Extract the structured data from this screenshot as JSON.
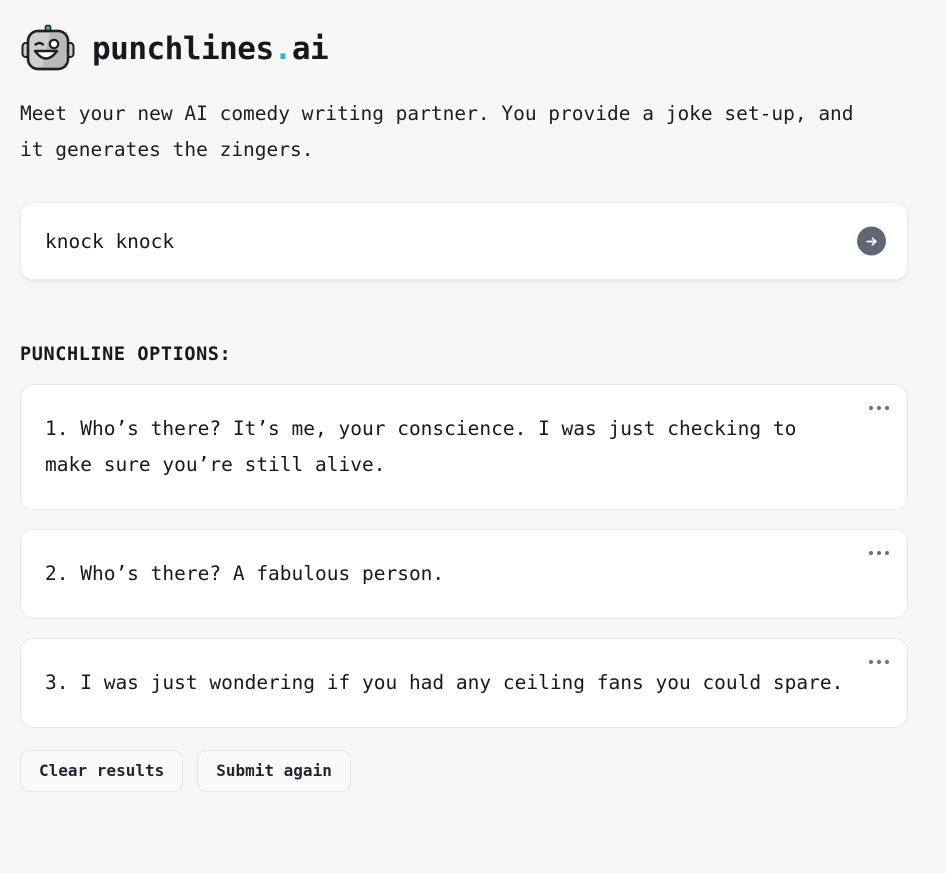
{
  "header": {
    "logo_icon": "robot-face-icon",
    "title_main": "punchlines",
    "title_dot": ".",
    "title_suffix": "ai",
    "accent_color": "#3bb3d9",
    "robot_colors": {
      "face_light": "#cfcfcf",
      "face_shadow": "#b3b3b3",
      "outline": "#1f1f1f",
      "antenna": "#3bb3d9"
    }
  },
  "tagline": "Meet your new AI comedy writing partner. You provide a joke set-up, and it generates the zingers.",
  "prompt": {
    "value": "knock knock",
    "placeholder": "Enter a joke set-up",
    "submit_icon": "arrow-right-icon",
    "submit_color": "#5f6775"
  },
  "results": {
    "label": "PUNCHLINE OPTIONS:",
    "menu_icon": "ellipsis-horizontal-icon",
    "items": [
      {
        "text": "1. Who’s there? It’s me, your conscience. I was just checking to make sure you’re still alive."
      },
      {
        "text": "2. Who’s there? A fabulous person."
      },
      {
        "text": "3. I was just wondering if you had any ceiling fans you could spare."
      }
    ]
  },
  "actions": {
    "clear_label": "Clear results",
    "submit_again_label": "Submit again"
  }
}
